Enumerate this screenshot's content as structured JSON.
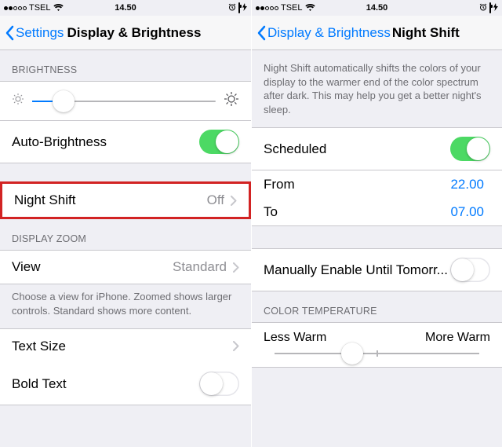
{
  "status": {
    "carrier": "TSEL",
    "time": "14.50"
  },
  "left": {
    "nav": {
      "back": "Settings",
      "title": "Display & Brightness"
    },
    "brightness_header": "BRIGHTNESS",
    "auto_brightness": "Auto-Brightness",
    "night_shift": {
      "label": "Night Shift",
      "value": "Off"
    },
    "zoom_header": "DISPLAY ZOOM",
    "view": {
      "label": "View",
      "value": "Standard"
    },
    "zoom_footer": "Choose a view for iPhone. Zoomed shows larger controls. Standard shows more content.",
    "text_size": "Text Size",
    "bold_text": "Bold Text"
  },
  "right": {
    "nav": {
      "back": "Display & Brightness",
      "title": "Night Shift"
    },
    "intro": "Night Shift automatically shifts the colors of your display to the warmer end of the color spectrum after dark. This may help you get a better night's sleep.",
    "scheduled": "Scheduled",
    "from": {
      "label": "From",
      "value": "22.00"
    },
    "to": {
      "label": "To",
      "value": "07.00"
    },
    "manual": "Manually Enable Until Tomorr...",
    "temp_header": "COLOR TEMPERATURE",
    "less_warm": "Less Warm",
    "more_warm": "More Warm"
  }
}
